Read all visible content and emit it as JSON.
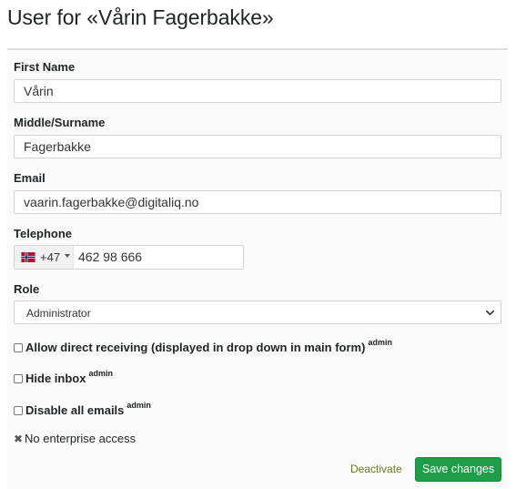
{
  "page": {
    "title": "User for «Vårin Fagerbakke»"
  },
  "form": {
    "first_name": {
      "label": "First Name",
      "value": "Vårin"
    },
    "surname": {
      "label": "Middle/Surname",
      "value": "Fagerbakke"
    },
    "email": {
      "label": "Email",
      "value": "vaarin.fagerbakke@digitaliq.no"
    },
    "telephone": {
      "label": "Telephone",
      "country_icon": "norway-flag-icon",
      "dial_code": "+47",
      "number": "462 98 666"
    },
    "role": {
      "label": "Role",
      "selected": "Administrator"
    },
    "checkboxes": [
      {
        "label": "Allow direct receiving (displayed in drop down in main form)",
        "badge": "admin",
        "checked": false
      },
      {
        "label": "Hide inbox",
        "badge": "admin",
        "checked": false
      },
      {
        "label": "Disable all emails",
        "badge": "admin",
        "checked": false
      }
    ],
    "enterprise_access": {
      "icon": "times-icon",
      "text": "No enterprise access"
    }
  },
  "actions": {
    "deactivate_label": "Deactivate",
    "save_label": "Save changes"
  },
  "colors": {
    "primary_button": "#1e9e48",
    "deactivate_link": "#6b7a1e",
    "card_bg": "#fafafa"
  }
}
